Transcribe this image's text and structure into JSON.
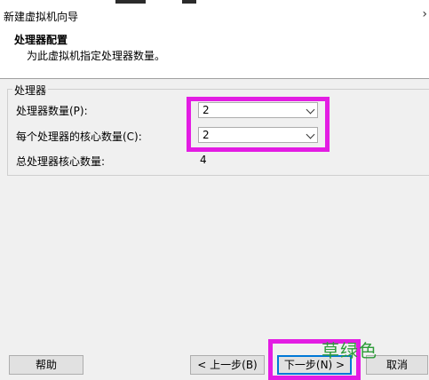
{
  "window": {
    "title": "新建虚拟机向导"
  },
  "header": {
    "title": "处理器配置",
    "subtitle": "为此虚拟机指定处理器数量。"
  },
  "group": {
    "label": "处理器"
  },
  "fields": {
    "processor_count_label": "处理器数量(P):",
    "processor_count_value": "2",
    "cores_label": "每个处理器的核心数量(C):",
    "cores_value": "2",
    "total_label": "总处理器核心数量:",
    "total_value": "4"
  },
  "buttons": {
    "help": "帮助",
    "back": "< 上一步(B)",
    "next": "下一步(N) >",
    "cancel": "取消"
  },
  "watermark": "草绿色",
  "highlight_color": "#e31ce3"
}
